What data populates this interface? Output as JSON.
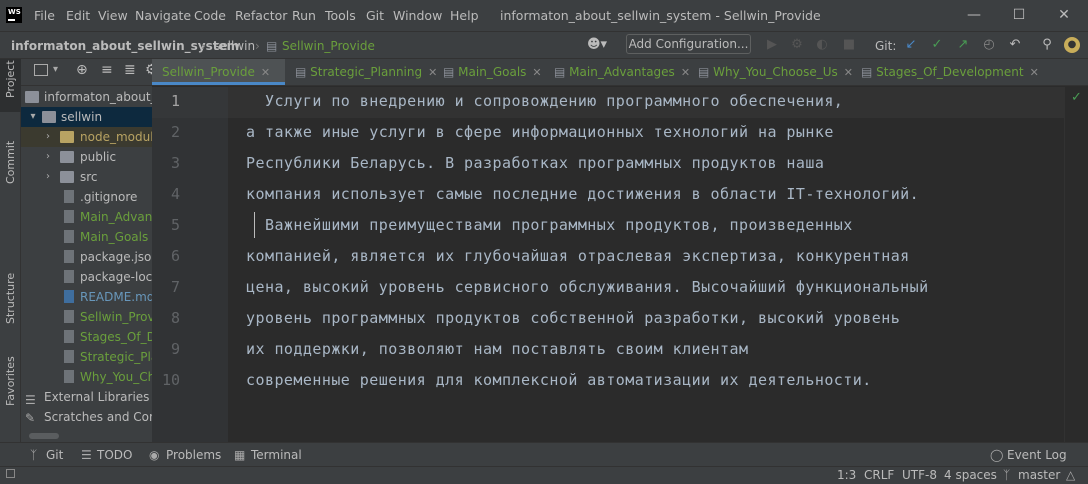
{
  "app": {
    "logo": "WS",
    "menu": [
      "File",
      "Edit",
      "View",
      "Navigate",
      "Code",
      "Refactor",
      "Run",
      "Tools",
      "Git",
      "Window",
      "Help"
    ],
    "window_title": "informaton_about_sellwin_system - Sellwin_Provide"
  },
  "nav": {
    "breadcrumbs": [
      "informaton_about_sellwin_system",
      "sellwin",
      "Sellwin_Provide"
    ],
    "add_configuration": "Add Configuration...",
    "git_label": "Git:"
  },
  "left_stripe": {
    "project": "Project",
    "commit": "Commit",
    "structure": "Structure",
    "favorites": "Favorites"
  },
  "project_tree": [
    {
      "label": "informaton_about_se"
    },
    {
      "label": "sellwin"
    },
    {
      "label": "node_modules"
    },
    {
      "label": "public"
    },
    {
      "label": "src"
    },
    {
      "label": ".gitignore"
    },
    {
      "label": "Main_Advanta"
    },
    {
      "label": "Main_Goals"
    },
    {
      "label": "package.json"
    },
    {
      "label": "package-lock"
    },
    {
      "label": "README.md"
    },
    {
      "label": "Sellwin_Provid"
    },
    {
      "label": "Stages_Of_De"
    },
    {
      "label": "Strategic_Plan"
    },
    {
      "label": "Why_You_Cho"
    },
    {
      "label": "External Libraries"
    },
    {
      "label": "Scratches and Consc"
    }
  ],
  "tabs": [
    {
      "label": "Sellwin_Provide"
    },
    {
      "label": "Strategic_Planning"
    },
    {
      "label": "Main_Goals"
    },
    {
      "label": "Main_Advantages"
    },
    {
      "label": "Why_You_Choose_Us"
    },
    {
      "label": "Stages_Of_Development"
    }
  ],
  "editor": {
    "line_numbers": [
      "1",
      "2",
      "3",
      "4",
      "5",
      "6",
      "7",
      "8",
      "9",
      "10"
    ],
    "lines": [
      "  Услуги по внедрению и сопровождению программного обеспечения,",
      "а также иные услуги в сфере информационных технологий на рынке",
      "Республики Беларусь. В разработках программных продуктов наша",
      "компания использует самые последние достижения в области IT-технологий.",
      "  Важнейшими преимуществами программных продуктов, произведенных",
      "компанией, является их глубочайшая отраслевая экспертиза, конкурентная",
      "цена, высокий уровень сервисного обслуживания. Высочайший функциональный",
      "уровень программных продуктов собственной разработки, высокий уровень",
      "их поддержки, позволяют нам поставлять своим клиентам",
      "современные решения для комплексной автоматизации их деятельности."
    ]
  },
  "tool_windows": {
    "git": "Git",
    "todo": "TODO",
    "problems": "Problems",
    "terminal": "Terminal",
    "event_log": "Event Log"
  },
  "status": {
    "position": "1:3",
    "line_sep": "CRLF",
    "encoding": "UTF-8",
    "indent": "4 spaces",
    "branch": "master"
  },
  "colors": {
    "accent": "#4a88c7",
    "modified_file": "#6a9f3c",
    "ignored_file": "#b8a363",
    "readme": "#6897bb"
  }
}
